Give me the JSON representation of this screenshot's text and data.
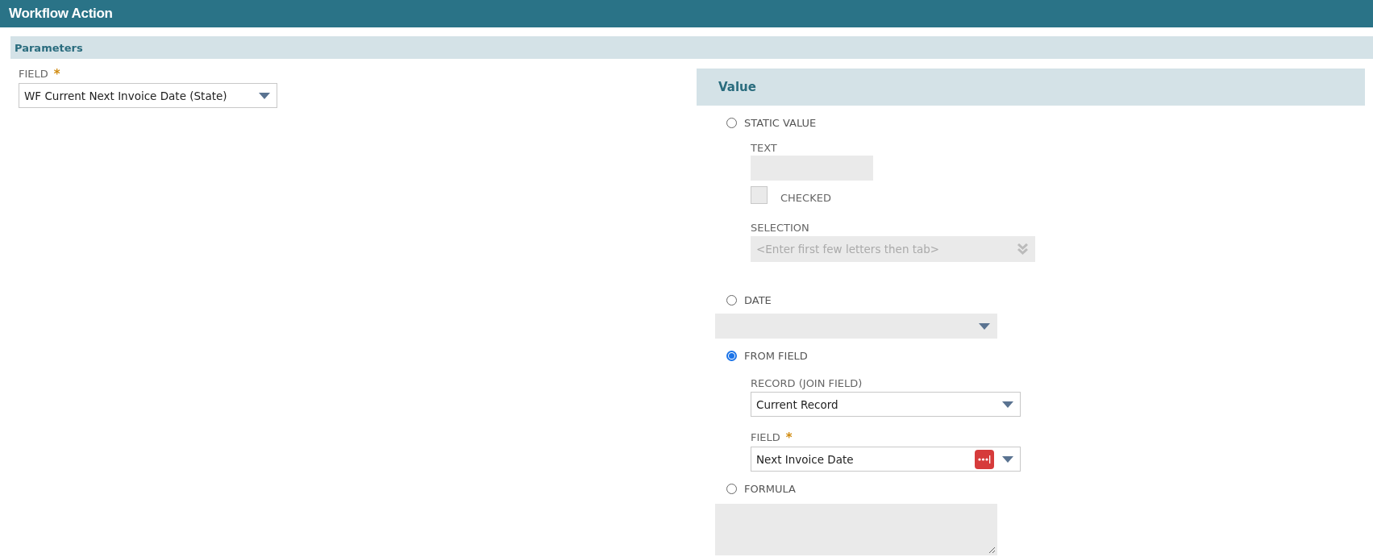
{
  "header": {
    "title": "Workflow Action"
  },
  "parameters": {
    "title": "Parameters",
    "field": {
      "label": "FIELD",
      "required_mark": "*",
      "value": "WF Current Next Invoice Date (State)"
    }
  },
  "value_panel": {
    "title": "Value",
    "options": [
      {
        "kind": "static",
        "label": "STATIC VALUE",
        "selected": false,
        "text": {
          "label": "TEXT"
        },
        "checkbox": {
          "label": "CHECKED",
          "checked": false
        },
        "selection": {
          "label": "SELECTION",
          "placeholder": "<Enter first few letters then tab>"
        }
      },
      {
        "kind": "date",
        "label": "DATE",
        "selected": false
      },
      {
        "kind": "from_field",
        "label": "FROM FIELD",
        "selected": true,
        "record": {
          "label": "RECORD (JOIN FIELD)",
          "value": "Current Record"
        },
        "field": {
          "label": "FIELD",
          "required_mark": "*",
          "value": "Next Invoice Date"
        }
      },
      {
        "kind": "formula",
        "label": "FORMULA",
        "selected": false
      }
    ]
  }
}
